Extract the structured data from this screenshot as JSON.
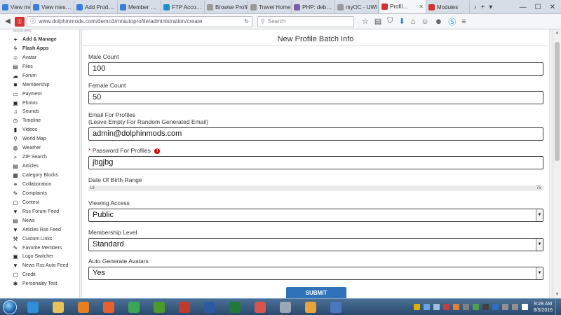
{
  "browser": {
    "tabs": [
      {
        "label": "View mes…",
        "icon_color": "#3b7dd8"
      },
      {
        "label": "View mes…",
        "icon_color": "#3b7dd8"
      },
      {
        "label": "Add Prod…",
        "icon_color": "#3b7dd8"
      },
      {
        "label": "Member …",
        "icon_color": "#3b7dd8"
      },
      {
        "label": "FTP Acco…",
        "icon_color": "#1e90c8"
      },
      {
        "label": "Browse Profiles",
        "icon_color": "#999999"
      },
      {
        "label": "Travel Home",
        "icon_color": "#999999"
      },
      {
        "label": "PHP: deb…",
        "icon_color": "#7a5ea8"
      },
      {
        "label": "myOC - UWI…",
        "icon_color": "#999999"
      },
      {
        "label": "Profil…",
        "icon_color": "#d23232",
        "active": true
      },
      {
        "label": "Modules",
        "icon_color": "#d23232"
      }
    ],
    "url": "www.dolphinmods.com/demo3/m/autoprofile/administration/create",
    "search_placeholder": "Search"
  },
  "sidebar": {
    "header": "Modules",
    "items": [
      {
        "label": "Add & Manage",
        "icon": "+",
        "bold": true
      },
      {
        "label": "Flash Apps",
        "icon": "ϟ",
        "bold": true
      },
      {
        "label": "Avatar",
        "icon": "☺"
      },
      {
        "label": "Files",
        "icon": "▤"
      },
      {
        "label": "Forum",
        "icon": "☁"
      },
      {
        "label": "Membership",
        "icon": "✸"
      },
      {
        "label": "Payment",
        "icon": "▭"
      },
      {
        "label": "Photos",
        "icon": "▣"
      },
      {
        "label": "Sounds",
        "icon": "♫"
      },
      {
        "label": "Timeline",
        "icon": "◷"
      },
      {
        "label": "Videos",
        "icon": "▮"
      },
      {
        "label": "World Map",
        "icon": "⚲"
      },
      {
        "label": "Weather",
        "icon": "◍"
      },
      {
        "label": "ZIP Search",
        "icon": "⌕"
      },
      {
        "label": "Articles",
        "icon": "▤"
      },
      {
        "label": "Category Blocks",
        "icon": "▦"
      },
      {
        "label": "Collaboration",
        "icon": "⚭"
      },
      {
        "label": "Complaints",
        "icon": "✎"
      },
      {
        "label": "Contest",
        "icon": "▢"
      },
      {
        "label": "Rss Forum Feed",
        "icon": "▼"
      },
      {
        "label": "News",
        "icon": "▤"
      },
      {
        "label": "Articles Rss Feed",
        "icon": "▼"
      },
      {
        "label": "Custom Links",
        "icon": "⚒"
      },
      {
        "label": "Favorite Members",
        "icon": "✎"
      },
      {
        "label": "Logo Switcher",
        "icon": "▣"
      },
      {
        "label": "News Rss Auto Feed",
        "icon": "▼"
      },
      {
        "label": "Credit",
        "icon": "▢"
      },
      {
        "label": "Personality Test",
        "icon": "✱"
      }
    ]
  },
  "form": {
    "title": "New Profile Batch Info",
    "male_count": {
      "label": "Male Count",
      "value": "100"
    },
    "female_count": {
      "label": "Female Count",
      "value": "50"
    },
    "email": {
      "label": "Email For Profiles",
      "note": "(Leave Empty For Random Generated Email)",
      "value": "admin@dolphinmods.com"
    },
    "password": {
      "required_mark": "*",
      "label": "Password For Profiles",
      "error_icon": "!",
      "value": "jbgjbg"
    },
    "dob_range": {
      "label": "Date Of Birth Range",
      "min": "18",
      "max": "75"
    },
    "viewing_access": {
      "label": "Viewing Access",
      "value": "Public"
    },
    "membership_level": {
      "label": "Membership Level",
      "value": "Standard"
    },
    "auto_avatars": {
      "label": "Auto Generate Avatars",
      "value": "Yes"
    },
    "submit_label": "SUBMIT"
  },
  "taskbar": {
    "apps": [
      {
        "name": "internet-explorer",
        "color": "#2f8fdc"
      },
      {
        "name": "file-explorer",
        "color": "#e8c25a"
      },
      {
        "name": "media-player",
        "color": "#e67e22"
      },
      {
        "name": "firefox",
        "color": "#e8602c"
      },
      {
        "name": "chrome",
        "color": "#3aa757"
      },
      {
        "name": "frog-app",
        "color": "#4c9a2a"
      },
      {
        "name": "filezilla",
        "color": "#c0392b"
      },
      {
        "name": "network-app",
        "color": "#2c5aa0"
      },
      {
        "name": "excel",
        "color": "#1f7a3a"
      },
      {
        "name": "eraser-app",
        "color": "#d9534f"
      },
      {
        "name": "calculator",
        "color": "#9aa7b5"
      },
      {
        "name": "outlook",
        "color": "#e8a33a"
      },
      {
        "name": "text-app",
        "color": "#4a78c0"
      }
    ],
    "tray_colors": [
      "#e0b000",
      "#66a3e0",
      "#a0c0e0",
      "#c04040",
      "#e08030",
      "#808080",
      "#50a050",
      "#404040",
      "#3070c0",
      "#909090",
      "#909090",
      "#ffffff"
    ],
    "time": "9:28 AM",
    "date": "8/5/2016"
  }
}
